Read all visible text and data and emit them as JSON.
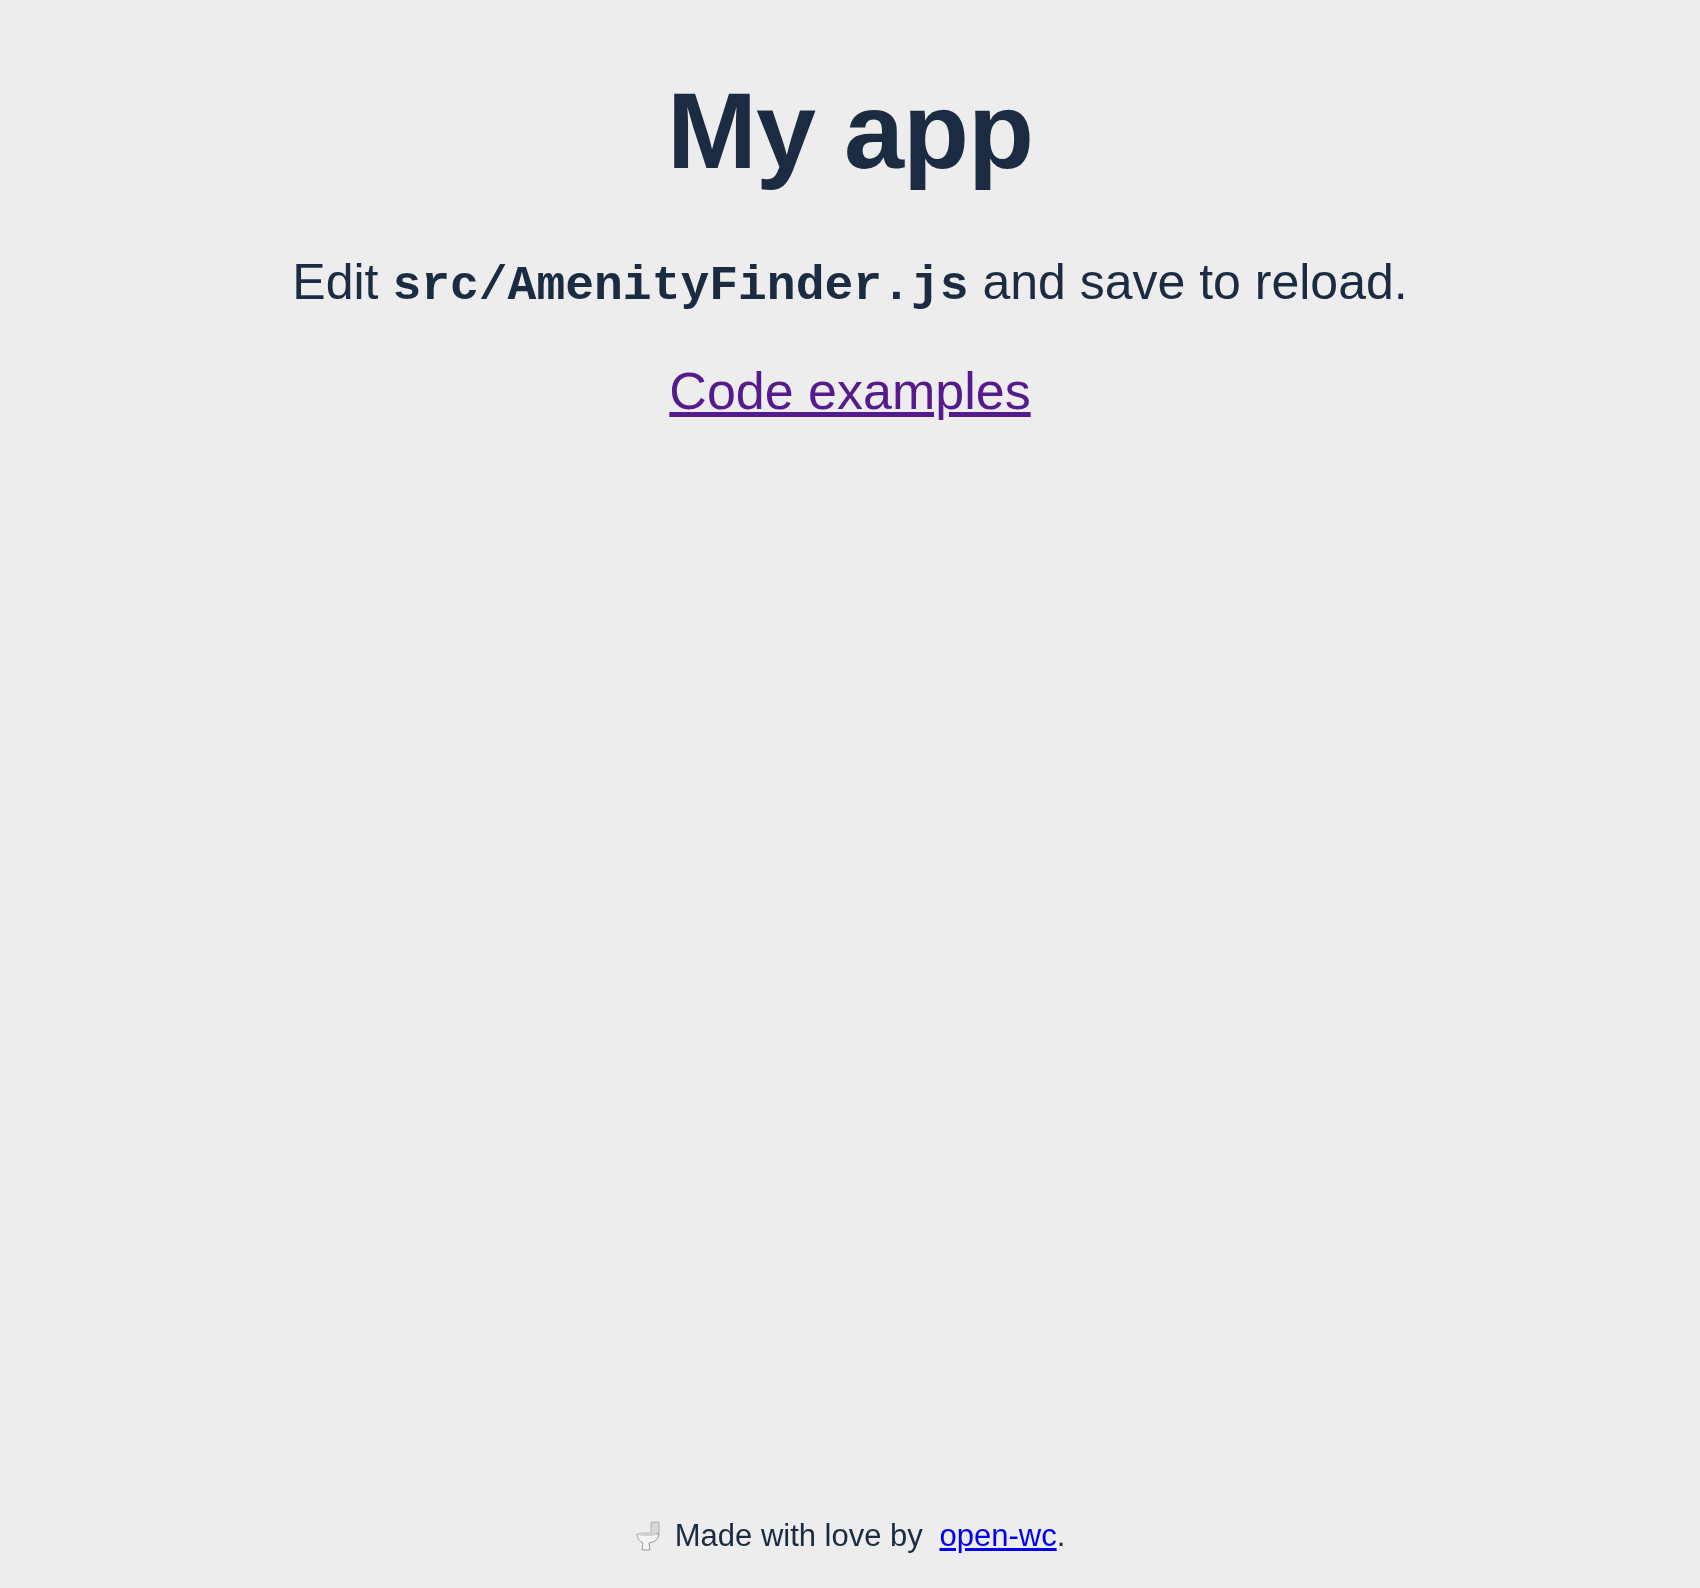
{
  "title": "My app",
  "instruction": {
    "before": "Edit ",
    "code": "src/AmenityFinder.js",
    "after": " and save to reload."
  },
  "link": {
    "label": "Code examples",
    "visited": true
  },
  "footer": {
    "before": "Made with love by ",
    "link": {
      "label": "open-wc",
      "visited": false
    },
    "after": "."
  }
}
